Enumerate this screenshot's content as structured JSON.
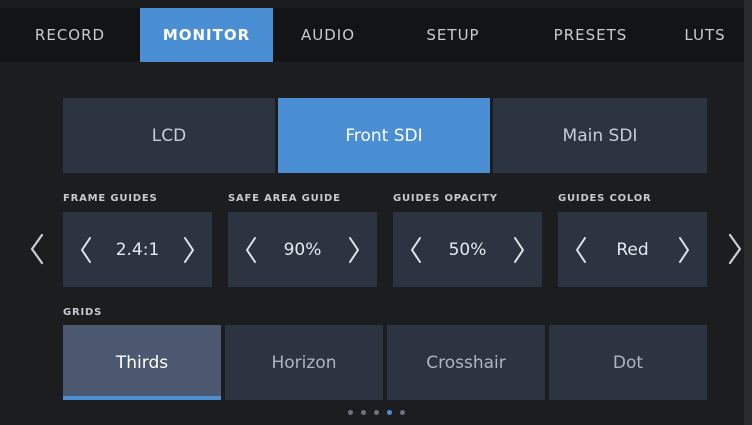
{
  "tabs": [
    {
      "label": "RECORD",
      "active": false
    },
    {
      "label": "MONITOR",
      "active": true
    },
    {
      "label": "AUDIO",
      "active": false
    },
    {
      "label": "SETUP",
      "active": false
    },
    {
      "label": "PRESETS",
      "active": false
    },
    {
      "label": "LUTS",
      "active": false
    }
  ],
  "outputs": [
    {
      "label": "LCD",
      "active": false
    },
    {
      "label": "Front SDI",
      "active": true
    },
    {
      "label": "Main SDI",
      "active": false
    }
  ],
  "settings": {
    "frame_guides": {
      "label": "FRAME GUIDES",
      "value": "2.4:1"
    },
    "safe_area_guide": {
      "label": "SAFE AREA GUIDE",
      "value": "90%"
    },
    "guides_opacity": {
      "label": "GUIDES OPACITY",
      "value": "50%"
    },
    "guides_color": {
      "label": "GUIDES COLOR",
      "value": "Red"
    }
  },
  "grids": {
    "label": "GRIDS",
    "options": [
      {
        "label": "Thirds",
        "active": true
      },
      {
        "label": "Horizon",
        "active": false
      },
      {
        "label": "Crosshair",
        "active": false
      },
      {
        "label": "Dot",
        "active": false
      }
    ]
  },
  "pager": {
    "count": 5,
    "active_index": 3
  },
  "colors": {
    "accent": "#4a8fd4",
    "panel": "#2c3441",
    "background": "#1c1d1f"
  },
  "icons": {
    "prev": "chevron-left-icon",
    "next": "chevron-right-icon"
  }
}
